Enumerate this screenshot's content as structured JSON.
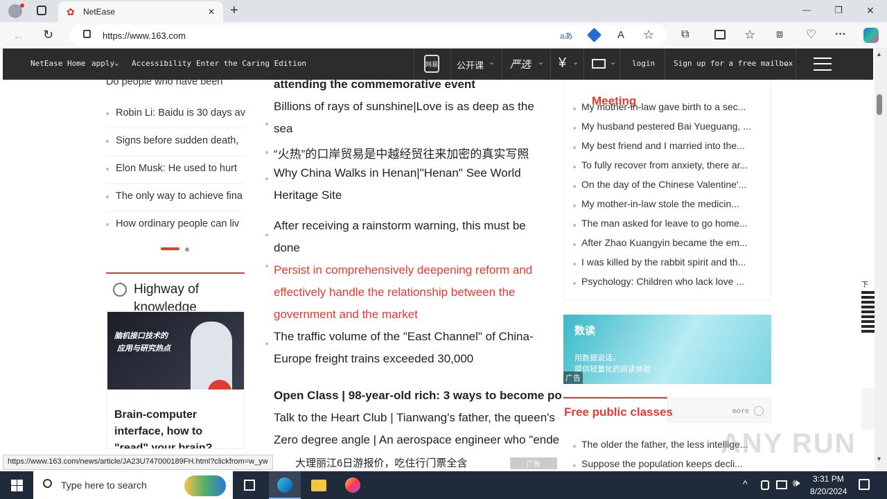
{
  "browser": {
    "tab_title": "NetEase",
    "url": "https://www.163.com",
    "new_tab": "+",
    "minimize": "—",
    "restore": "❐",
    "close": "✕",
    "tab_close": "✕",
    "translate": "aあ",
    "read_aloud": "A",
    "more": "···",
    "status_url": "https://www.163.com/news/article/JA23U747000189FH.html?clickfrom=w_yw"
  },
  "nav": {
    "home": "NetEase Home",
    "apply": "apply",
    "accessibility": "Accessibility",
    "caring": "Enter the Caring Edition",
    "open_class": "公开课",
    "yanxuan": "严选",
    "login": "login",
    "signup": "Sign up for a free mailbox",
    "phone_label": "网易"
  },
  "left": {
    "cut_top": "Do people who have been",
    "items": [
      "Robin Li: Baidu is 30 days av",
      "Signs before sudden death,",
      "Elon Musk: He used to hurt",
      "The only way to achieve fina",
      "How ordinary people can liv"
    ],
    "section_title": "Highway of knowledge",
    "video_text1": "脑机接口技术的",
    "video_text2": "应用与研究热点",
    "video_caption": "Brain-computer interface, how to \"read\" your brain?"
  },
  "center": {
    "items": [
      {
        "text": "attending the commemorative event",
        "style": "bold"
      },
      {
        "text": "Billions of rays of sunshine|Love is as deep as the",
        "style": ""
      },
      {
        "text": "sea",
        "style": ""
      },
      {
        "text": "“火热”的口岸贸易是中越经贸往来加密的真实写照",
        "style": ""
      },
      {
        "text": "Why China Walks in Henan|\"Henan\" See World",
        "style": ""
      },
      {
        "text": "Heritage Site",
        "style": ""
      },
      {
        "text": "After receiving a rainstorm warning, this must be",
        "style": ""
      },
      {
        "text": "done",
        "style": ""
      },
      {
        "text": "Persist in comprehensively deepening reform and",
        "style": "red"
      },
      {
        "text": "effectively handle the relationship between the",
        "style": "red"
      },
      {
        "text": "government and the market",
        "style": "red"
      },
      {
        "text": "The traffic volume of the \"East Channel\" of China-",
        "style": ""
      },
      {
        "text": "Europe freight trains exceeded 30,000",
        "style": ""
      },
      {
        "text": "Open Class | 98-year-old rich: 3 ways to become po",
        "style": "bold"
      },
      {
        "text": "Talk to the Heart Club | Tianwang's father, the queen's",
        "style": ""
      },
      {
        "text": "Zero degree angle | An aerospace engineer who \"ende",
        "style": ""
      },
      {
        "text": "大理丽江6日游报价，吃住行门票全含",
        "style": ""
      }
    ],
    "ad_label": "广告"
  },
  "right": {
    "meeting": "Meeting",
    "items": [
      "My mother-in-law gave birth to a sec...",
      "My husband pestered Bai Yueguang, ...",
      "My best friend and I married into the...",
      "To fully recover from anxiety, there ar...",
      "On the day of the Chinese Valentine'...",
      "My mother-in-law stole the medicin...",
      "The man asked for leave to go home...",
      "After Zhao Kuangyin became the em...",
      "I was killed by the rabbit spirit and th...",
      "Psychology: Children who lack love ..."
    ],
    "ad_title": "数读",
    "ad_line1": "用数据说话，",
    "ad_line2": "提供轻量化的阅读体验",
    "ad_label": "广告",
    "classes_title": "Free public classes",
    "more": "more",
    "class_items": [
      "The older the father, the less intellige...",
      "Suppose the population keeps decli..."
    ],
    "side_label": "下载"
  },
  "taskbar": {
    "search_placeholder": "Type here to search",
    "time": "3:31 PM",
    "date": "8/20/2024"
  },
  "watermark": "ANY RUN"
}
